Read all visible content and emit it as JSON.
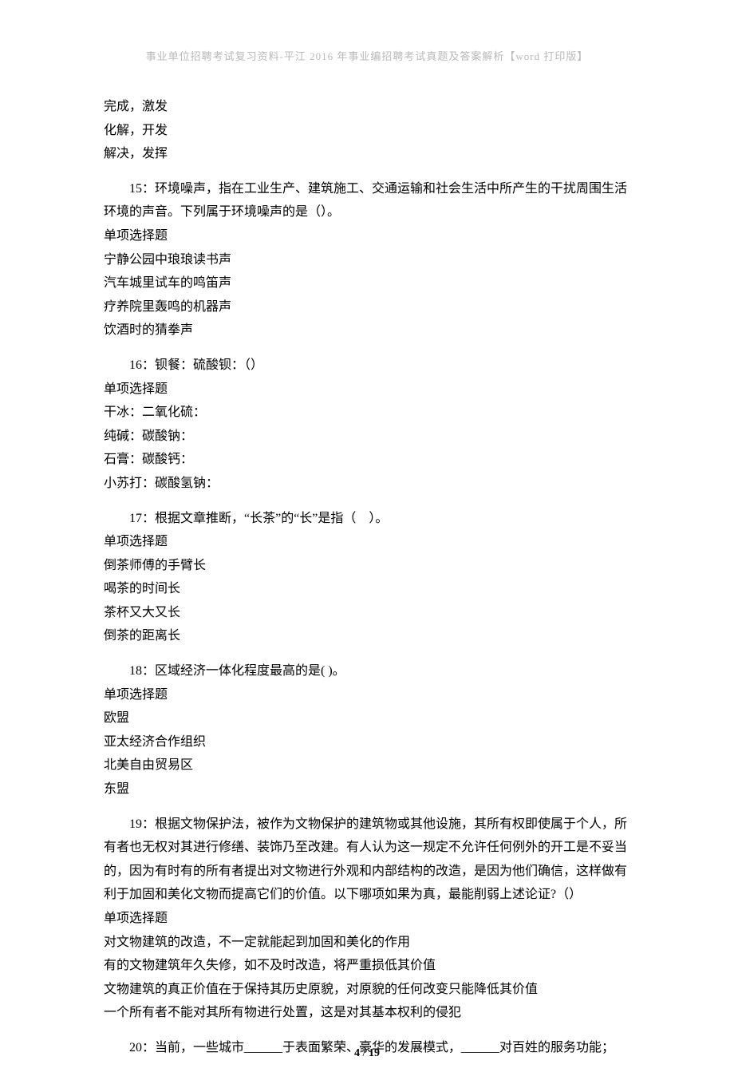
{
  "header": "事业单位招聘考试复习资料-平江 2016 年事业编招聘考试真题及答案解析【word 打印版】",
  "top_options": [
    "完成，激发",
    "化解，开发",
    "解决，发挥"
  ],
  "questions": [
    {
      "text": "15：环境噪声，指在工业生产、建筑施工、交通运输和社会生活中所产生的干扰周围生活环境的声音。下列属于环境噪声的是（）。",
      "type": "单项选择题",
      "options": [
        "宁静公园中琅琅读书声",
        "汽车城里试车的鸣笛声",
        "疗养院里轰鸣的机器声",
        "饮酒时的猜拳声"
      ]
    },
    {
      "text": "16：钡餐：硫酸钡：（）",
      "type": "单项选择题",
      "options": [
        "干冰：二氧化硫：",
        "纯碱：碳酸钠：",
        "石膏：碳酸钙：",
        "小苏打：碳酸氢钠："
      ]
    },
    {
      "text": "17：根据文章推断，“长茶”的“长”是指（　）。",
      "type": "单项选择题",
      "options": [
        "倒茶师傅的手臂长",
        "喝茶的时间长",
        "茶杯又大又长",
        "倒茶的距离长"
      ]
    },
    {
      "text": "18：区域经济一体化程度最高的是( )。",
      "type": "单项选择题",
      "options": [
        "欧盟",
        "亚太经济合作组织",
        "北美自由贸易区",
        "东盟"
      ]
    },
    {
      "text": "19：根据文物保护法，被作为文物保护的建筑物或其他设施，其所有权即使属于个人，所有者也无权对其进行修缮、装饰乃至改建。有人认为这一规定不允许任何例外的开工是不妥当的，因为有时有的所有者提出对文物进行外观和内部结构的改造，是因为他们确信，这样做有利于加固和美化文物而提高它们的价值。以下哪项如果为真，最能削弱上述论证?（）",
      "type": "单项选择题",
      "options": [
        "对文物建筑的改造，不一定就能起到加固和美化的作用",
        "有的文物建筑年久失修，如不及时改造，将严重损低其价值",
        "文物建筑的真正价值在于保持其历史原貌，对原貌的任何改变只能降低其价值",
        "一个所有者不能对其所有物进行处置，这是对其基本权利的侵犯"
      ]
    },
    {
      "text": "20：当前，一些城市______于表面繁荣、豪华的发展模式，______对百姓的服务功能；",
      "type": "",
      "options": []
    }
  ],
  "footer": {
    "page_current": "4",
    "page_total": "19"
  }
}
